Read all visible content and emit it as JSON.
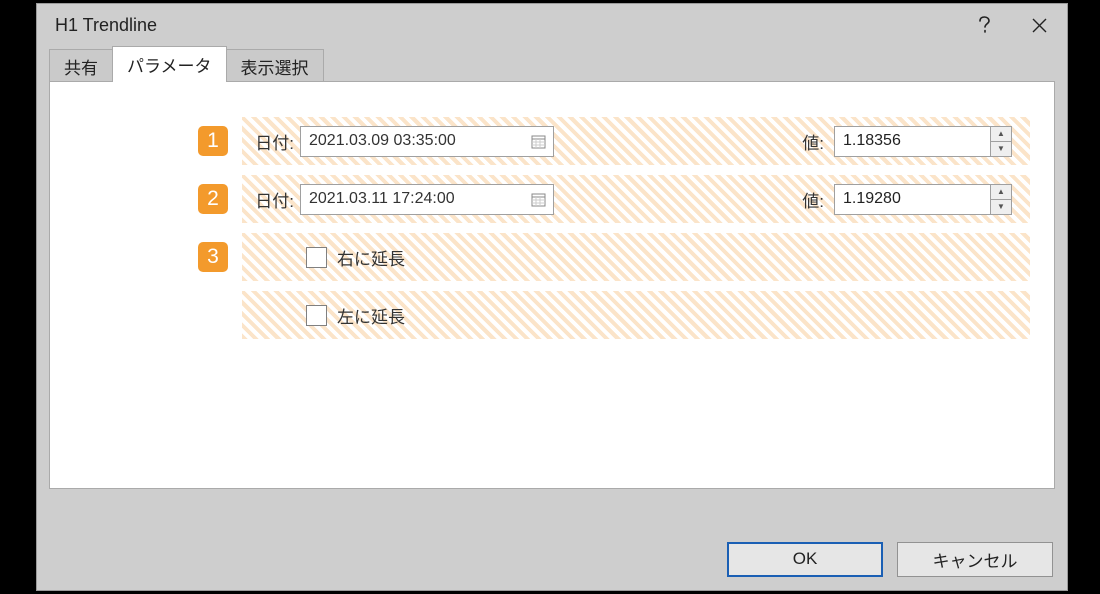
{
  "title": "H1 Trendline",
  "tabs": {
    "share": "共有",
    "params": "パラメータ",
    "display": "表示選択"
  },
  "rows": [
    {
      "marker": "1",
      "date_label": "日付:",
      "date_value": "2021.03.09 03:35:00",
      "value_label": "値:",
      "value": "1.18356"
    },
    {
      "marker": "2",
      "date_label": "日付:",
      "date_value": "2021.03.11 17:24:00",
      "value_label": "値:",
      "value": "1.19280"
    }
  ],
  "marker3": "3",
  "extend_right": "右に延長",
  "extend_left": "左に延長",
  "buttons": {
    "ok": "OK",
    "cancel": "キャンセル"
  }
}
